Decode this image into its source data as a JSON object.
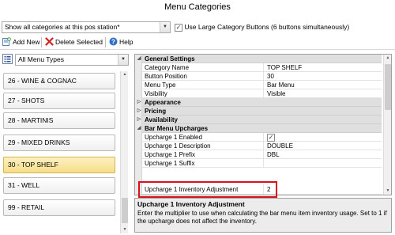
{
  "window": {
    "title": "Menu Categories"
  },
  "top_filter": {
    "category_dropdown_value": "Show all categories at this pos station*",
    "large_buttons_checked": true,
    "large_buttons_label": "Use Large Category Buttons (6 buttons simultaneously)"
  },
  "toolbar": {
    "add_new_label": "Add New",
    "delete_selected_label": "Delete Selected",
    "help_label": "Help"
  },
  "left_panel": {
    "menu_type_dropdown_value": "All Menu Types",
    "categories": [
      {
        "label": "26 - WINE & COGNAC",
        "selected": false
      },
      {
        "label": "27 - SHOTS",
        "selected": false
      },
      {
        "label": "28 - MARTINIS",
        "selected": false
      },
      {
        "label": "29 - MIXED DRINKS",
        "selected": false
      },
      {
        "label": "30 - TOP SHELF",
        "selected": true
      },
      {
        "label": "31 - WELL",
        "selected": false
      },
      {
        "label": "99 - RETAIL",
        "selected": false
      }
    ]
  },
  "property_grid": {
    "sections": [
      {
        "name": "General Settings",
        "expanded": true,
        "rows": [
          {
            "key": "Category Name",
            "value": "TOP SHELF"
          },
          {
            "key": "Button Position",
            "value": "30"
          },
          {
            "key": "Menu Type",
            "value": "Bar Menu"
          },
          {
            "key": "Visibility",
            "value": "Visible"
          }
        ]
      },
      {
        "name": "Appearance",
        "expanded": false,
        "rows": []
      },
      {
        "name": "Pricing",
        "expanded": false,
        "rows": []
      },
      {
        "name": "Availability",
        "expanded": false,
        "rows": []
      },
      {
        "name": "Bar Menu Upcharges",
        "expanded": true,
        "rows": [
          {
            "key": "Upcharge 1 Enabled",
            "value": "",
            "checkbox": true,
            "checked": true
          },
          {
            "key": "Upcharge 1 Description",
            "value": "DOUBLE"
          },
          {
            "key": "Upcharge 1 Prefix",
            "value": "DBL"
          },
          {
            "key": "Upcharge 1 Suffix",
            "value": ""
          },
          {
            "key": "Upcharge 1 Inventory Adjustment",
            "value": "2",
            "highlighted": true
          }
        ]
      }
    ]
  },
  "description": {
    "title": "Upcharge 1 Inventory Adjustment",
    "text": "Enter the multiplier to use when calculating the bar menu item inventory usage. Set to 1 if the upcharge does not affect the inventory."
  },
  "colors": {
    "selected_category_bg": "#f7dd88",
    "highlight_border": "#d9111b",
    "section_header_bg": "#dfdfdf"
  }
}
